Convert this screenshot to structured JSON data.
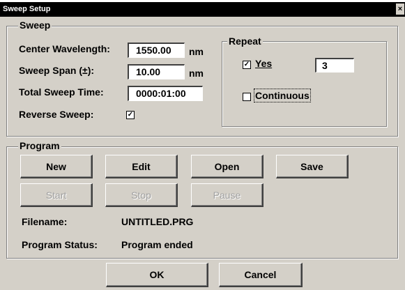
{
  "window": {
    "title": "Sweep Setup",
    "close_glyph": "×"
  },
  "sweep": {
    "legend": "Sweep",
    "center_wavelength_label": "Center Wavelength:",
    "center_wavelength_value": "1550.00",
    "center_wavelength_unit": "nm",
    "span_label": "Sweep Span (±):",
    "span_value": "10.00",
    "span_unit": "nm",
    "time_label": "Total Sweep Time:",
    "time_value": "0000:01:00",
    "reverse_label": "Reverse Sweep:",
    "reverse_checked": true
  },
  "repeat": {
    "legend": "Repeat",
    "yes_label": "Yes",
    "yes_checked": true,
    "count_value": "3",
    "continuous_label": "Continuous",
    "continuous_checked": false
  },
  "program": {
    "legend": "Program",
    "buttons": {
      "new": "New",
      "edit": "Edit",
      "open": "Open",
      "save": "Save",
      "start": "Start",
      "stop": "Stop",
      "pause": "Pause"
    },
    "filename_label": "Filename:",
    "filename_value": "UNTITLED.PRG",
    "status_label": "Program Status:",
    "status_value": "Program ended"
  },
  "dialog_buttons": {
    "ok": "OK",
    "cancel": "Cancel"
  },
  "glyphs": {
    "checkmark": "✓"
  }
}
